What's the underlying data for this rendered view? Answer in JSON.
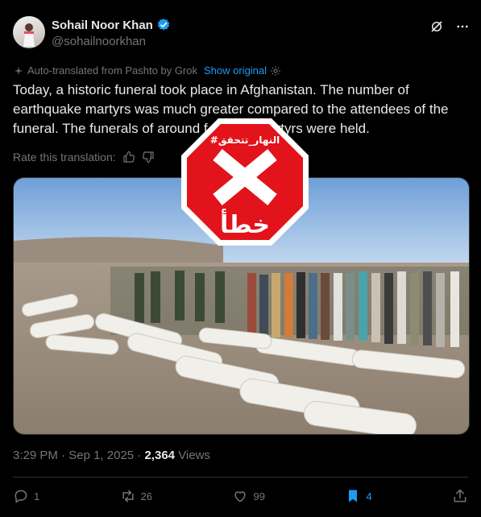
{
  "author": {
    "name": "Sohail Noor Khan",
    "handle": "@sohailnoorkhan",
    "verified": true
  },
  "translation": {
    "note": "Auto-translated from Pashto by Grok",
    "show_original": "Show original",
    "rate_label": "Rate this translation:"
  },
  "tweet": {
    "text": "Today, a historic funeral took place in Afghanistan. The number of earthquake martyrs was much greater compared to the attendees of the funeral. The funerals of around f          d martyrs were held."
  },
  "stamp": {
    "tag": "#النهار_تتحقق",
    "verdict": "خطأ",
    "color": "#e2131b"
  },
  "meta": {
    "time": "3:29 PM",
    "date": "Sep 1, 2025",
    "views_count": "2,364",
    "views_label": "Views"
  },
  "actions": {
    "replies": "1",
    "reposts": "26",
    "likes": "99",
    "bookmarks": "4"
  },
  "colors": {
    "accent": "#1d9bf0",
    "muted": "#71767b",
    "background": "#000000"
  },
  "icons": [
    "verified-badge-icon",
    "grok-icon",
    "more-icon",
    "translate-icon",
    "settings-icon",
    "thumbs-up-icon",
    "thumbs-down-icon",
    "reply-icon",
    "repost-icon",
    "like-icon",
    "bookmark-icon",
    "share-icon"
  ]
}
